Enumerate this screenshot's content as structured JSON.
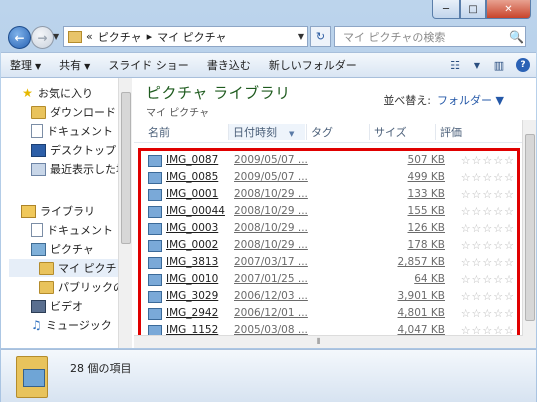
{
  "window": {
    "caption": {
      "minimize": "─",
      "maximize": "□",
      "close": "✕"
    }
  },
  "navigation": {
    "back_icon": "←",
    "forward_icon": "→",
    "history_dropdown": "▼",
    "address": {
      "overflow": "«",
      "segments": [
        "ピクチャ",
        "▸",
        "マイ ピクチャ"
      ],
      "dropdown": "▼"
    },
    "refresh_icon": "↻",
    "search": {
      "placeholder": "マイ ピクチャの検索",
      "icon": "🔍"
    }
  },
  "toolbar": {
    "organize": "整理",
    "share": "共有",
    "slideshow": "スライド ショー",
    "burn": "書き込む",
    "new_folder": "新しいフォルダー",
    "dropdown_arrow": "▼",
    "views_icon": "☷",
    "preview_icon": "▥",
    "help_icon": "?"
  },
  "sidebar": {
    "items": [
      {
        "label": "お気に入り",
        "icon": "star-icon"
      },
      {
        "label": "ダウンロード",
        "icon": "folder-icon"
      },
      {
        "label": "ドキュメント",
        "icon": "document-icon"
      },
      {
        "label": "デスクトップ",
        "icon": "desktop-icon"
      },
      {
        "label": "最近表示した場所",
        "icon": "recent-places-icon"
      },
      {
        "label": "ライブラリ",
        "icon": "library-icon"
      },
      {
        "label": "ドキュメント",
        "icon": "document-icon"
      },
      {
        "label": "ピクチャ",
        "icon": "pictures-icon"
      },
      {
        "label": "マイ ピクチャ",
        "icon": "folder-icon"
      },
      {
        "label": "パブリックのピ",
        "icon": "folder-icon"
      },
      {
        "label": "ビデオ",
        "icon": "video-icon"
      },
      {
        "label": "ミュージック",
        "icon": "music-icon"
      }
    ]
  },
  "library": {
    "title": "ピクチャ ライブラリ",
    "subtitle": "マイ ピクチャ",
    "arrange_label": "並べ替え:",
    "arrange_value": "フォルダー ▼"
  },
  "columns": {
    "name": "名前",
    "date": "日付時刻",
    "tags": "タグ",
    "size": "サイズ",
    "rating": "評価",
    "sort_indicator": "▼"
  },
  "files": [
    {
      "name": "IMG_0087",
      "date": "2009/05/07 ...",
      "size": "507 KB",
      "rating": "☆☆☆☆☆"
    },
    {
      "name": "IMG_0085",
      "date": "2009/05/07 ...",
      "size": "499 KB",
      "rating": "☆☆☆☆☆"
    },
    {
      "name": "IMG_0001",
      "date": "2008/10/29 ...",
      "size": "133 KB",
      "rating": "☆☆☆☆☆"
    },
    {
      "name": "IMG_00044",
      "date": "2008/10/29 ...",
      "size": "155 KB",
      "rating": "☆☆☆☆☆"
    },
    {
      "name": "IMG_0003",
      "date": "2008/10/29 ...",
      "size": "126 KB",
      "rating": "☆☆☆☆☆"
    },
    {
      "name": "IMG_0002",
      "date": "2008/10/29 ...",
      "size": "178 KB",
      "rating": "☆☆☆☆☆"
    },
    {
      "name": "IMG_3813",
      "date": "2007/03/17 ...",
      "size": "2,857 KB",
      "rating": "☆☆☆☆☆"
    },
    {
      "name": "IMG_0010",
      "date": "2007/01/25 ...",
      "size": "64 KB",
      "rating": "☆☆☆☆☆"
    },
    {
      "name": "IMG_3029",
      "date": "2006/12/03 ...",
      "size": "3,901 KB",
      "rating": "☆☆☆☆☆"
    },
    {
      "name": "IMG_2942",
      "date": "2006/12/01 ...",
      "size": "4,801 KB",
      "rating": "☆☆☆☆☆"
    },
    {
      "name": "IMG_1152",
      "date": "2005/03/08 ...",
      "size": "4,047 KB",
      "rating": "☆☆☆☆☆"
    }
  ],
  "scrollbar": {
    "grip": "⦀"
  },
  "status": {
    "item_count": "28 個の項目"
  },
  "colors": {
    "highlight_box": "#e00000",
    "library_title": "#1e5b1e"
  }
}
